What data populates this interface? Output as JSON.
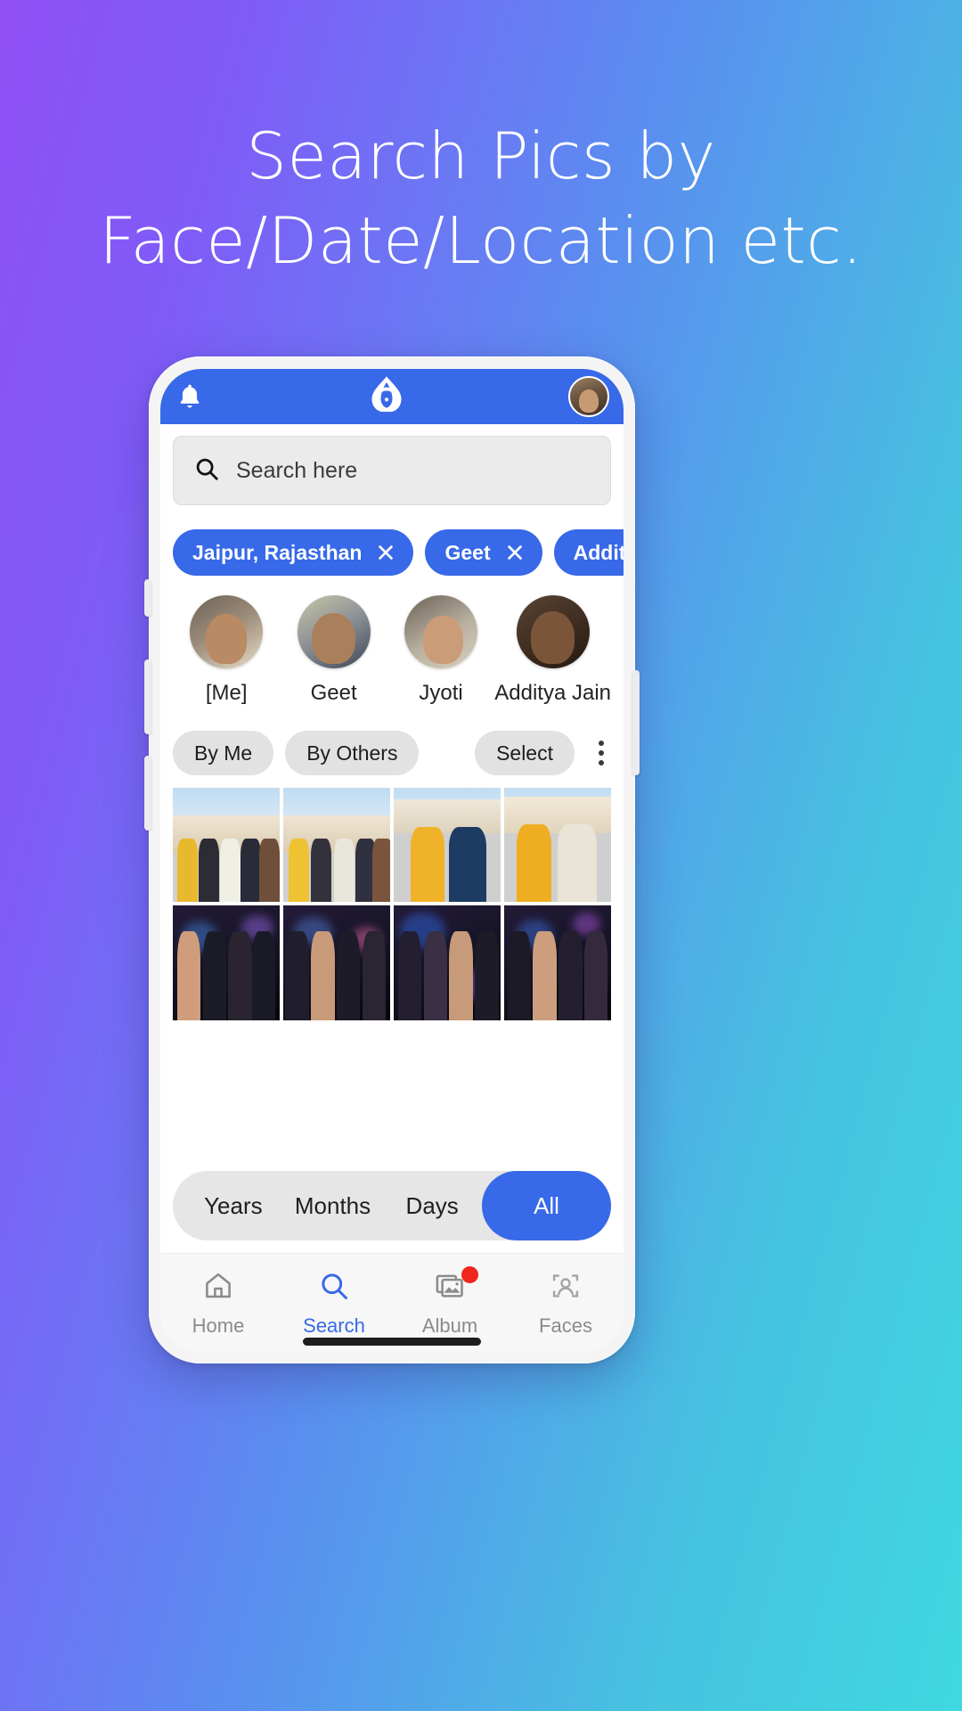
{
  "headline": {
    "line1": "Search Pics by",
    "line2": "Face/Date/Location etc."
  },
  "colors": {
    "accent_blue": "#3769e8",
    "bg_gradient_start": "#8f4ff5",
    "bg_gradient_end": "#3fd8e0",
    "badge_red": "#f0261f",
    "chip_grey": "#e2e2e2"
  },
  "appbar": {
    "notification_icon": "bell-icon",
    "logo_icon": "triquetra-logo",
    "profile_icon": "user-avatar"
  },
  "search": {
    "icon": "search-icon",
    "placeholder": "Search here",
    "value": ""
  },
  "filter_chips": [
    {
      "label": "Jaipur, Rajasthan",
      "remove_icon": "close-icon"
    },
    {
      "label": "Geet",
      "remove_icon": "close-icon"
    },
    {
      "label": "Additya Jain",
      "remove_icon": "close-icon"
    }
  ],
  "faces": [
    {
      "name": "[Me]"
    },
    {
      "name": "Geet"
    },
    {
      "name": "Jyoti"
    },
    {
      "name": "Additya Jain"
    }
  ],
  "toolbar": {
    "by_me": "By Me",
    "by_others": "By Others",
    "select": "Select",
    "overflow_icon": "kebab-menu-icon"
  },
  "photo_grid": {
    "rows": 2,
    "columns": 4,
    "photos": [
      {
        "scene": "daylight-group-outdoor"
      },
      {
        "scene": "daylight-group-outdoor"
      },
      {
        "scene": "daylight-two-men"
      },
      {
        "scene": "daylight-two-men"
      },
      {
        "scene": "night-party-group"
      },
      {
        "scene": "night-party-group"
      },
      {
        "scene": "night-party-group"
      },
      {
        "scene": "night-party-group"
      }
    ]
  },
  "segmented": {
    "options": [
      "Years",
      "Months",
      "Days",
      "All"
    ],
    "selected": "All"
  },
  "bottom_nav": [
    {
      "label": "Home",
      "icon": "home-icon",
      "active": false,
      "badge": false
    },
    {
      "label": "Search",
      "icon": "search-icon",
      "active": true,
      "badge": false
    },
    {
      "label": "Album",
      "icon": "album-icon",
      "active": false,
      "badge": true
    },
    {
      "label": "Faces",
      "icon": "faces-icon",
      "active": false,
      "badge": false
    }
  ]
}
